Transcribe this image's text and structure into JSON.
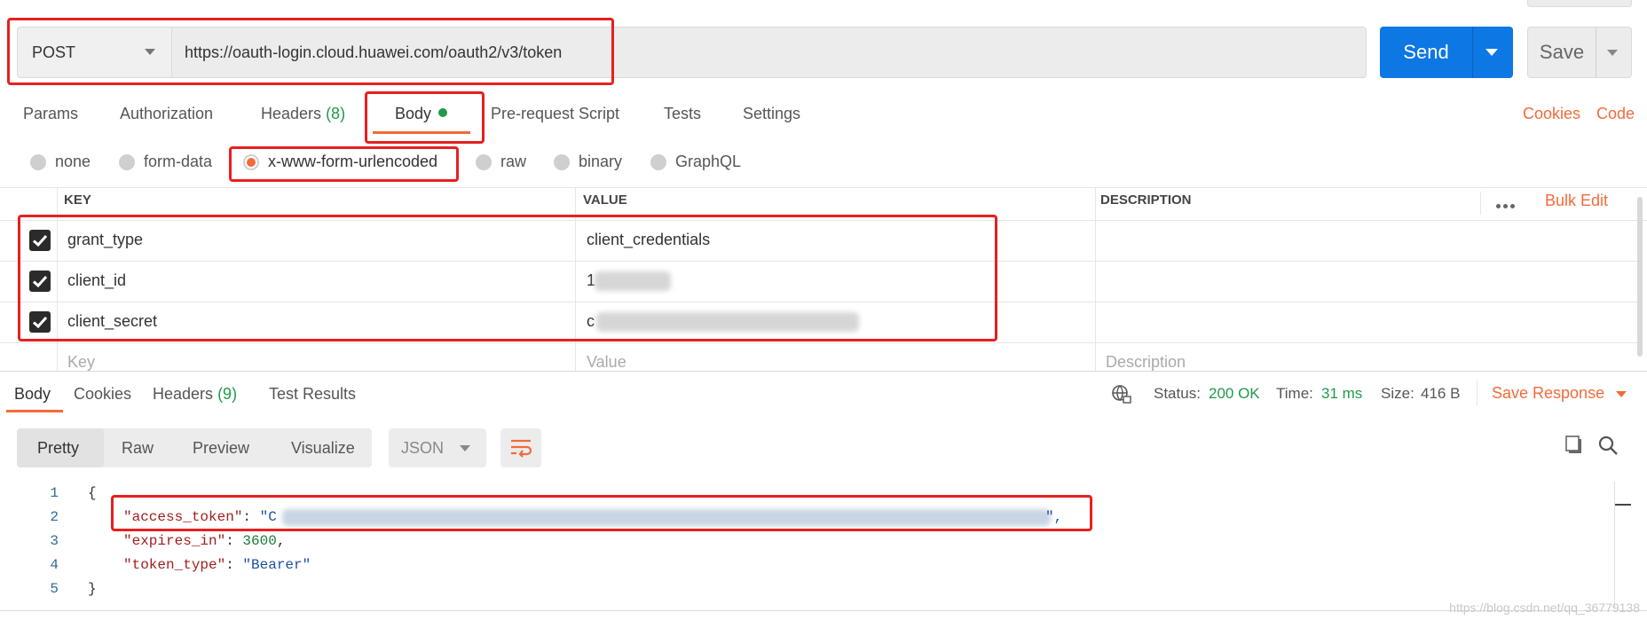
{
  "request": {
    "method": "POST",
    "url": "https://oauth-login.cloud.huawei.com/oauth2/v3/token",
    "send_label": "Send",
    "save_label": "Save"
  },
  "request_tabs": [
    {
      "label": "Params"
    },
    {
      "label": "Authorization"
    },
    {
      "label": "Headers",
      "count": "(8)"
    },
    {
      "label": "Body",
      "active": true
    },
    {
      "label": "Pre-request Script"
    },
    {
      "label": "Tests"
    },
    {
      "label": "Settings"
    }
  ],
  "links": {
    "cookies": "Cookies",
    "code": "Code"
  },
  "body_types": [
    {
      "label": "none"
    },
    {
      "label": "form-data"
    },
    {
      "label": "x-www-form-urlencoded",
      "selected": true
    },
    {
      "label": "raw"
    },
    {
      "label": "binary"
    },
    {
      "label": "GraphQL"
    }
  ],
  "table": {
    "headers": {
      "key": "KEY",
      "value": "VALUE",
      "description": "DESCRIPTION"
    },
    "bulk_edit": "Bulk Edit",
    "rows": [
      {
        "key": "grant_type",
        "value": "client_credentials",
        "checked": true
      },
      {
        "key": "client_id",
        "value": "1",
        "checked": true
      },
      {
        "key": "client_secret",
        "value": "c",
        "checked": true
      }
    ],
    "placeholders": {
      "key": "Key",
      "value": "Value",
      "description": "Description"
    }
  },
  "response": {
    "tabs": [
      {
        "label": "Body",
        "active": true
      },
      {
        "label": "Cookies"
      },
      {
        "label": "Headers",
        "count": "(9)"
      },
      {
        "label": "Test Results"
      }
    ],
    "status_label": "Status:",
    "status_value": "200 OK",
    "time_label": "Time:",
    "time_value": "31 ms",
    "size_label": "Size:",
    "size_value": "416 B",
    "save_response": "Save Response",
    "view_modes": [
      "Pretty",
      "Raw",
      "Preview",
      "Visualize"
    ],
    "format": "JSON",
    "code_lines": [
      {
        "n": "1",
        "text": "{"
      },
      {
        "n": "2",
        "key": "\"access_token\"",
        "value": "\"C",
        "tail": "\","
      },
      {
        "n": "3",
        "key": "\"expires_in\"",
        "num": "3600",
        "tail": ","
      },
      {
        "n": "4",
        "key": "\"token_type\"",
        "value": "\"Bearer\""
      },
      {
        "n": "5",
        "text": "}"
      }
    ]
  },
  "watermark": "https://blog.csdn.net/qq_36779138",
  "colors": {
    "accent": "#f26b3a",
    "send": "#0d77e4",
    "success": "#1f9a4a",
    "highlight": "#e81f1f"
  }
}
